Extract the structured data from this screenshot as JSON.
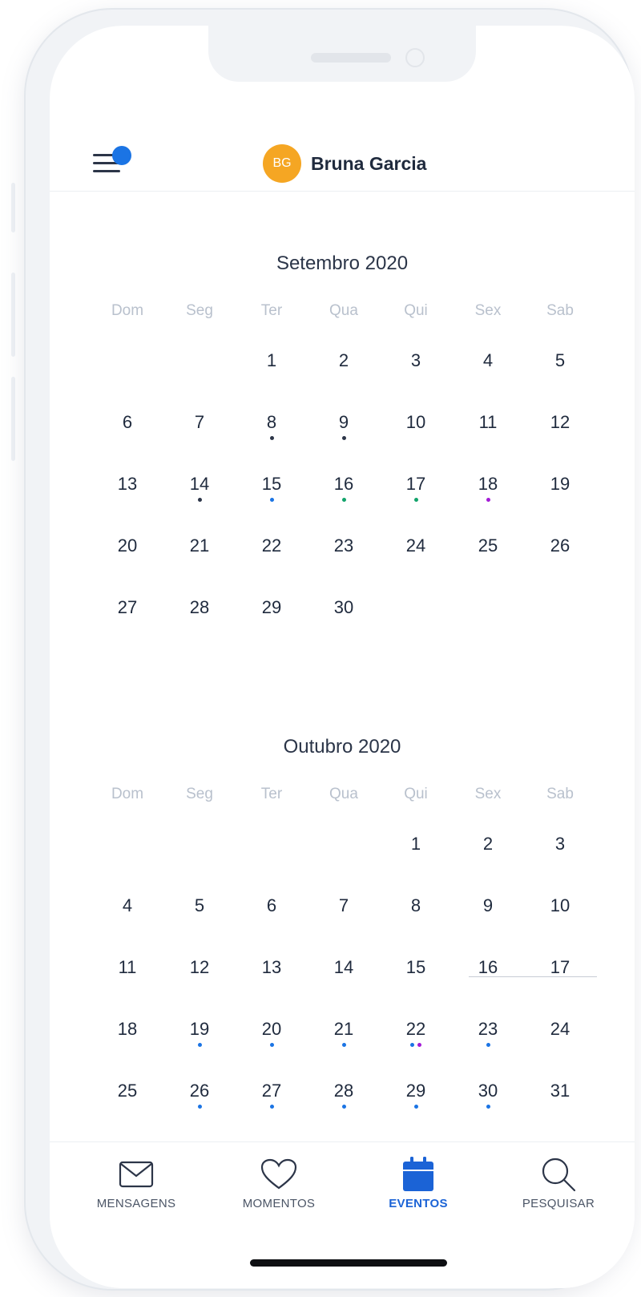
{
  "header": {
    "avatar_initials": "BG",
    "user_name": "Bruna Garcia",
    "avatar_color": "#f5a623",
    "menu_icon": "hamburger-menu-icon"
  },
  "weekday_labels": [
    "Dom",
    "Seg",
    "Ter",
    "Qua",
    "Qui",
    "Sex",
    "Sab"
  ],
  "months": [
    {
      "title": "Setembro 2020",
      "weeks": [
        [
          null,
          null,
          {
            "d": "1"
          },
          {
            "d": "2"
          },
          {
            "d": "3"
          },
          {
            "d": "4"
          },
          {
            "d": "5"
          }
        ],
        [
          {
            "d": "6"
          },
          {
            "d": "7"
          },
          {
            "d": "8",
            "dots": [
              "#2c3548"
            ]
          },
          {
            "d": "9",
            "dots": [
              "#2c3548"
            ]
          },
          {
            "d": "10"
          },
          {
            "d": "11"
          },
          {
            "d": "12"
          }
        ],
        [
          {
            "d": "13"
          },
          {
            "d": "14",
            "dots": [
              "#2c3548"
            ]
          },
          {
            "d": "15",
            "dots": [
              "#1b74e4"
            ]
          },
          {
            "d": "16",
            "dots": [
              "#12a36b"
            ]
          },
          {
            "d": "17",
            "dots": [
              "#12a36b"
            ]
          },
          {
            "d": "18",
            "dots": [
              "#a31bd6"
            ]
          },
          {
            "d": "19"
          }
        ],
        [
          {
            "d": "20"
          },
          {
            "d": "21"
          },
          {
            "d": "22"
          },
          {
            "d": "23"
          },
          {
            "d": "24"
          },
          {
            "d": "25"
          },
          {
            "d": "26"
          }
        ],
        [
          {
            "d": "27"
          },
          {
            "d": "28"
          },
          {
            "d": "29"
          },
          {
            "d": "30"
          },
          null,
          null,
          null
        ]
      ]
    },
    {
      "title": "Outubro 2020",
      "weeks": [
        [
          null,
          null,
          null,
          null,
          {
            "d": "1"
          },
          {
            "d": "2"
          },
          {
            "d": "3"
          }
        ],
        [
          {
            "d": "4"
          },
          {
            "d": "5"
          },
          {
            "d": "6"
          },
          {
            "d": "7"
          },
          {
            "d": "8"
          },
          {
            "d": "9"
          },
          {
            "d": "10"
          }
        ],
        [
          {
            "d": "11"
          },
          {
            "d": "12"
          },
          {
            "d": "13"
          },
          {
            "d": "14"
          },
          {
            "d": "15"
          },
          {
            "d": "16"
          },
          {
            "d": "17"
          }
        ],
        [
          {
            "d": "18"
          },
          {
            "d": "19",
            "dots": [
              "#1b74e4"
            ]
          },
          {
            "d": "20",
            "dots": [
              "#1b74e4"
            ]
          },
          {
            "d": "21",
            "dots": [
              "#1b74e4"
            ]
          },
          {
            "d": "22",
            "dots": [
              "#1b74e4",
              "#a31bd6"
            ]
          },
          {
            "d": "23",
            "dots": [
              "#1b74e4"
            ]
          },
          {
            "d": "24"
          }
        ],
        [
          {
            "d": "25"
          },
          {
            "d": "26",
            "dots": [
              "#1b74e4"
            ]
          },
          {
            "d": "27",
            "dots": [
              "#1b74e4"
            ]
          },
          {
            "d": "28",
            "dots": [
              "#1b74e4"
            ]
          },
          {
            "d": "29",
            "dots": [
              "#1b74e4"
            ]
          },
          {
            "d": "30",
            "dots": [
              "#1b74e4"
            ]
          },
          {
            "d": "31"
          }
        ]
      ]
    }
  ],
  "tabs": [
    {
      "label": "MENSAGENS",
      "icon": "envelope-icon",
      "active": false
    },
    {
      "label": "MOMENTOS",
      "icon": "heart-icon",
      "active": false
    },
    {
      "label": "EVENTOS",
      "icon": "calendar-icon",
      "active": true
    },
    {
      "label": "PESQUISAR",
      "icon": "search-icon",
      "active": false
    }
  ],
  "colors": {
    "accent": "#1b63d6",
    "text": "#1f2a3d",
    "muted": "#b9c1cd"
  }
}
